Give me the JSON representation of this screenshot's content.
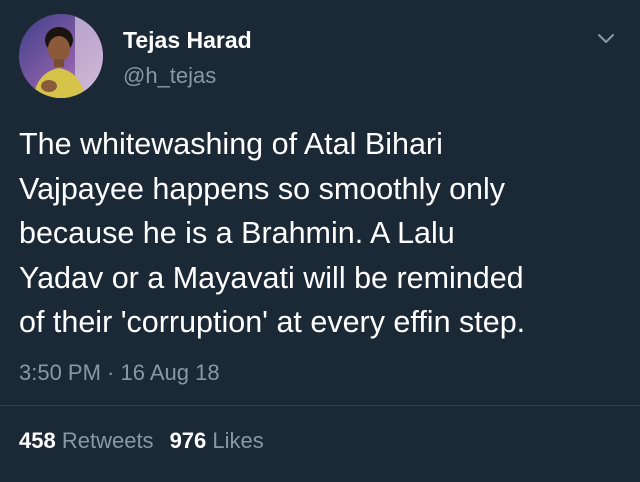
{
  "user": {
    "display_name": "Tejas Harad",
    "handle": "@h_tejas",
    "avatar_icon": "profile-photo-icon"
  },
  "menu": {
    "icon": "chevron-down-icon"
  },
  "tweet": {
    "lines": [
      "The whitewashing of Atal Bihari",
      "Vajpayee happens so smoothly only",
      "because he is a Brahmin. A Lalu",
      "Yadav or a Mayavati will be reminded",
      "of their 'corruption' at every effin step."
    ],
    "timestamp": "3:50 PM · 16 Aug 18"
  },
  "stats": {
    "retweets_count": "458",
    "retweets_label": "Retweets",
    "likes_count": "976",
    "likes_label": "Likes"
  },
  "colors": {
    "background": "#1b2836",
    "primary_text": "#ffffff",
    "secondary_text": "#8899a6",
    "divider": "#38444d"
  }
}
